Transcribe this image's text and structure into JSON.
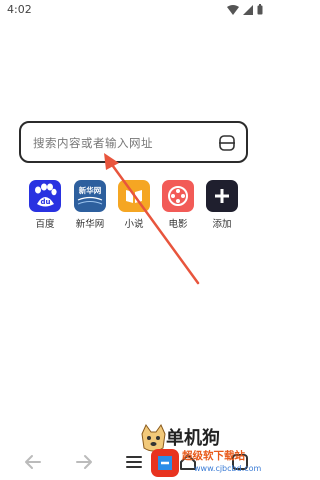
{
  "status": {
    "time": "4:02"
  },
  "search": {
    "placeholder": "搜索内容或者输入网址"
  },
  "shortcuts": [
    {
      "label": "百度",
      "icon": "baidu-icon",
      "color": "#2932e1"
    },
    {
      "label": "新华网",
      "icon": "xinhua-icon",
      "color": "#2d5f9e"
    },
    {
      "label": "小说",
      "icon": "book-icon",
      "color": "#f5a623"
    },
    {
      "label": "电影",
      "icon": "film-reel-icon",
      "color": "#f25b57"
    },
    {
      "label": "添加",
      "icon": "plus-icon",
      "color": "#1f1f2e"
    }
  ],
  "tile_text": {
    "baidu": "du",
    "xinhua": "新华网"
  },
  "watermark": {
    "title": "单机狗",
    "sub": "超级软下载站",
    "url": "www.cjbcbd.com"
  },
  "colors": {
    "arrow": "#e8553d",
    "accent": "#2932e1"
  }
}
